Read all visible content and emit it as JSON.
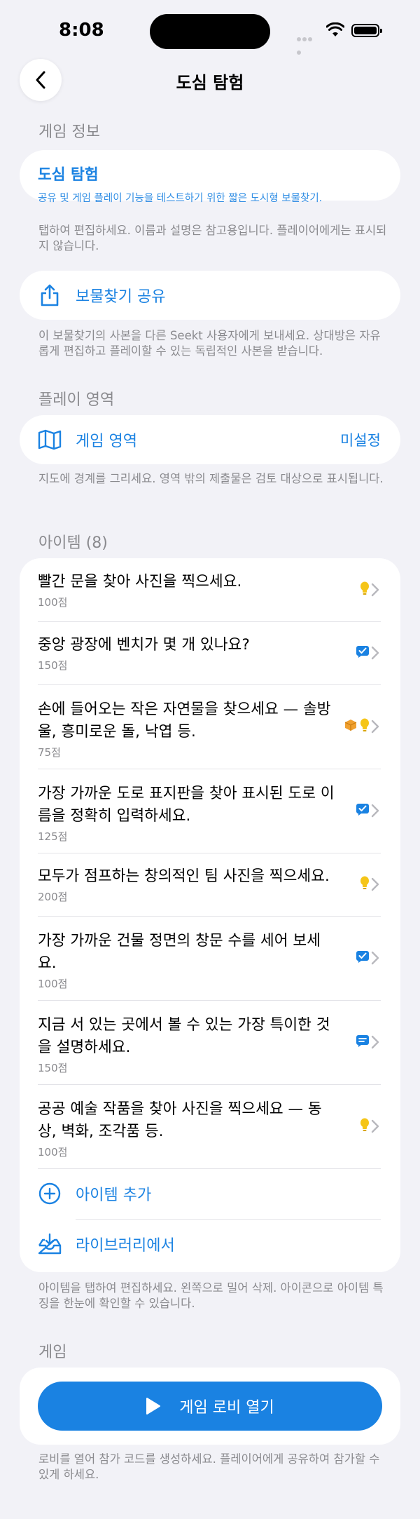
{
  "status_bar": {
    "time": "8:08"
  },
  "nav": {
    "title": "도심 탐험"
  },
  "game_info": {
    "header": "게임 정보",
    "title": "도심 탐험",
    "description": "공유 및 게임 플레이 기능을 테스트하기 위한 짧은 도시형 보물찾기.",
    "footnote": "탭하여 편집하세요. 이름과 설명은 참고용입니다. 플레이어에게는 표시되지 않습니다."
  },
  "share": {
    "label": "보물찾기 공유",
    "footnote": "이 보물찾기의 사본을 다른 Seekt 사용자에게 보내세요. 상대방은 자유롭게 편집하고 플레이할 수 있는 독립적인 사본을 받습니다."
  },
  "play_area": {
    "header": "플레이 영역",
    "label": "게임 영역",
    "value": "미설정",
    "footnote": "지도에 경계를 그리세요. 영역 밖의 제출물은 검토 대상으로 표시됩니다."
  },
  "items_section": {
    "header": "아이템 (8)",
    "items": [
      {
        "title": "빨간 문을 찾아 사진을 찍으세요.",
        "points": "100점",
        "badges": [
          "hint-bulb-icon"
        ]
      },
      {
        "title": "중앙 광장에 벤치가 몇 개 있나요?",
        "points": "150점",
        "badges": [
          "checkbox-answer-icon"
        ]
      },
      {
        "title": "손에 들어오는 작은 자연물을 찾으세요 — 솔방울, 흥미로운 돌, 낙엽 등.",
        "points": "75점",
        "badges": [
          "package-icon",
          "hint-bulb-icon"
        ]
      },
      {
        "title": "가장 가까운 도로 표지판을 찾아 표시된 도로 이름을 정확히 입력하세요.",
        "points": "125점",
        "badges": [
          "checkbox-answer-icon"
        ]
      },
      {
        "title": "모두가 점프하는 창의적인 팀 사진을 찍으세요.",
        "points": "200점",
        "badges": [
          "hint-bulb-icon"
        ]
      },
      {
        "title": "가장 가까운 건물 정면의 창문 수를 세어 보세요.",
        "points": "100점",
        "badges": [
          "checkbox-answer-icon"
        ]
      },
      {
        "title": "지금 서 있는 곳에서 볼 수 있는 가장 특이한 것을 설명하세요.",
        "points": "150점",
        "badges": [
          "text-answer-icon"
        ]
      },
      {
        "title": "공공 예술 작품을 찾아 사진을 찍으세요 — 동상, 벽화, 조각품 등.",
        "points": "100점",
        "badges": [
          "hint-bulb-icon"
        ]
      }
    ],
    "add_label": "아이템 추가",
    "library_label": "라이브러리에서",
    "footnote": "아이템을 탭하여 편집하세요. 왼쪽으로 밀어 삭제. 아이콘으로 아이템 특징을 한눈에 확인할 수 있습니다."
  },
  "game": {
    "header": "게임",
    "button_label": "게임 로비 열기",
    "footnote": "로비를 열어 참가 코드를 생성하세요. 플레이어에게 공유하여 참가할 수 있게 하세요."
  },
  "colors": {
    "accent": "#1a82e2",
    "background": "#f2f2f7",
    "secondary_text": "#8a8a8e",
    "hint": "#f5c518",
    "package": "#f0a030"
  }
}
